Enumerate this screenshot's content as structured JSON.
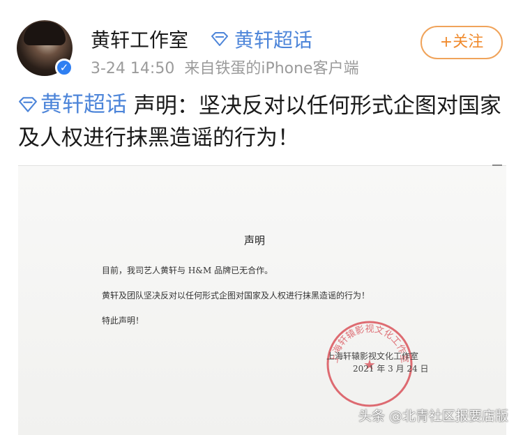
{
  "header": {
    "username": "黄轩工作室",
    "supertopic": "黄轩超话",
    "time": "3-24 14:50",
    "source": "来自铁蛋的iPhone客户端",
    "follow_label": "+关注",
    "verified_icon": "✓"
  },
  "post": {
    "tag": "黄轩超话",
    "text": " 声明：坚决反对以任何形式企图对国家及人权进行抹黑造谣的行为！"
  },
  "document": {
    "title": "声明",
    "line1": "目前，我司艺人黄轩与 H&M 品牌已无合作。",
    "line2": "黄轩及团队坚决反对以任何形式企图对国家及人权进行抹黑造谣的行为！",
    "line3": "特此声明！",
    "org": "上海轩辕影视文化工作室",
    "date": "2021 年 3 月 24 日",
    "seal_text": "上海轩辕影视文化工作室"
  },
  "watermark": "头条 @北青社区报要店版",
  "colors": {
    "link_blue": "#4d85d9",
    "follow_orange": "#f08a2c",
    "seal_red": "#d9525a",
    "meta_gray": "#9b9b9b"
  },
  "icons": {
    "supertopic": "diamond-icon",
    "verified": "verified-check-icon",
    "avatar": "user-avatar"
  }
}
